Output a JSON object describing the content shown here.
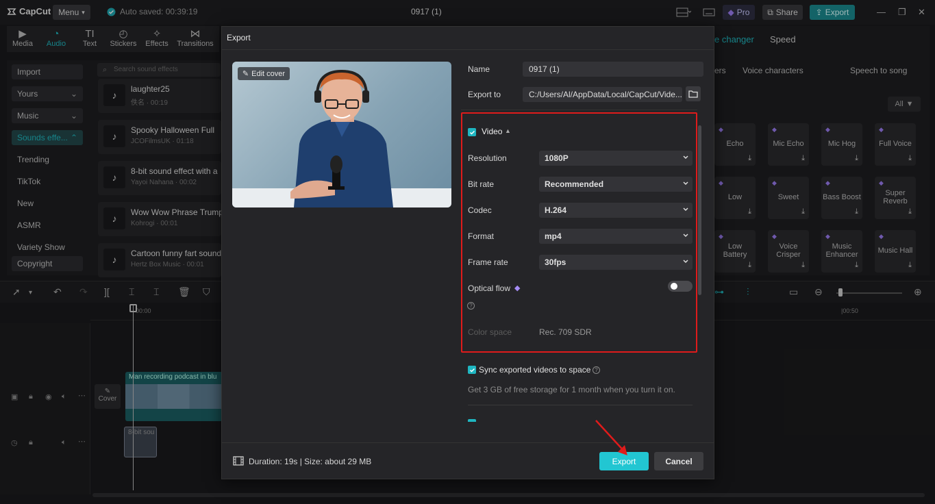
{
  "app": {
    "logo_text": "CapCut",
    "menu_label": "Menu",
    "autosave_text": "Auto saved: 00:39:19",
    "project_title": "0917 (1)",
    "pro_label": "Pro",
    "share_label": "Share",
    "export_label": "Export"
  },
  "toolbar": {
    "items": [
      {
        "label": "Media",
        "icon": "media-icon"
      },
      {
        "label": "Audio",
        "icon": "audio-icon"
      },
      {
        "label": "Text",
        "icon": "text-icon"
      },
      {
        "label": "Stickers",
        "icon": "stickers-icon"
      },
      {
        "label": "Effects",
        "icon": "effects-icon"
      },
      {
        "label": "Transitions",
        "icon": "transitions-icon"
      }
    ],
    "active": "Audio"
  },
  "sidebar": {
    "items": [
      {
        "label": "Import"
      },
      {
        "label": "Yours"
      },
      {
        "label": "Music"
      },
      {
        "label": "Sounds effe..."
      },
      {
        "label": "Trending"
      },
      {
        "label": "TikTok"
      },
      {
        "label": "New"
      },
      {
        "label": "ASMR"
      },
      {
        "label": "Variety Show"
      },
      {
        "label": "Copyright"
      }
    ]
  },
  "sounds": {
    "search_placeholder": "Search sound effects",
    "items": [
      {
        "title": "laughter25",
        "sub": "佚名 · 00:19"
      },
      {
        "title": "Spooky Halloween Full",
        "sub": "JCOFilmsUK · 01:18"
      },
      {
        "title": "8-bit sound effect with a",
        "sub": "Yayoi Nahana · 00:02"
      },
      {
        "title": "Wow Wow Phrase Trumpet",
        "sub": "Kohrogi · 00:01"
      },
      {
        "title": "Cartoon funny fart sound",
        "sub": "Hertz Box Music · 00:01"
      }
    ]
  },
  "right_panel": {
    "tabs": [
      "e changer",
      "Speed"
    ],
    "subtabs": [
      "ers",
      "Voice characters",
      "Speech to song"
    ],
    "filter_label": "All",
    "cards": [
      {
        "name": "Echo"
      },
      {
        "name": "Mic Echo"
      },
      {
        "name": "Mic Hog"
      },
      {
        "name": "Full Voice"
      },
      {
        "name": "Low"
      },
      {
        "name": "Sweet"
      },
      {
        "name": "Bass Boost"
      },
      {
        "name": "Super Reverb"
      },
      {
        "name": "Low Battery"
      },
      {
        "name": "Voice Crisper"
      },
      {
        "name": "Music Enhancer"
      },
      {
        "name": "Music Hall"
      }
    ]
  },
  "timeline": {
    "ruler_start": "00:00",
    "ruler_end": "|00:50",
    "cover_label": "Cover",
    "video_clip_label": "Man recording podcast in blu",
    "audio_clip_label": "8-bit sou"
  },
  "export_dialog": {
    "title": "Export",
    "edit_cover_label": "Edit cover",
    "name_label": "Name",
    "name_value": "0917 (1)",
    "export_to_label": "Export to",
    "export_to_value": "C:/Users/Al/AppData/Local/CapCut/Vide...",
    "video_section_label": "Video",
    "resolution_label": "Resolution",
    "resolution_value": "1080P",
    "bitrate_label": "Bit rate",
    "bitrate_value": "Recommended",
    "codec_label": "Codec",
    "codec_value": "H.264",
    "format_label": "Format",
    "format_value": "mp4",
    "framerate_label": "Frame rate",
    "framerate_value": "30fps",
    "optical_flow_label": "Optical flow",
    "color_space_label": "Color space",
    "color_space_value": "Rec. 709 SDR",
    "sync_label": "Sync exported videos to space",
    "sync_hint": "Get 3 GB of free storage for 1 month when you turn it on.",
    "duration_size": "Duration: 19s | Size: about 29 MB",
    "export_button": "Export",
    "cancel_button": "Cancel"
  },
  "colors": {
    "accent": "#22c6d2",
    "highlight_box": "#e01b1b",
    "arrow": "#e01b1b"
  }
}
